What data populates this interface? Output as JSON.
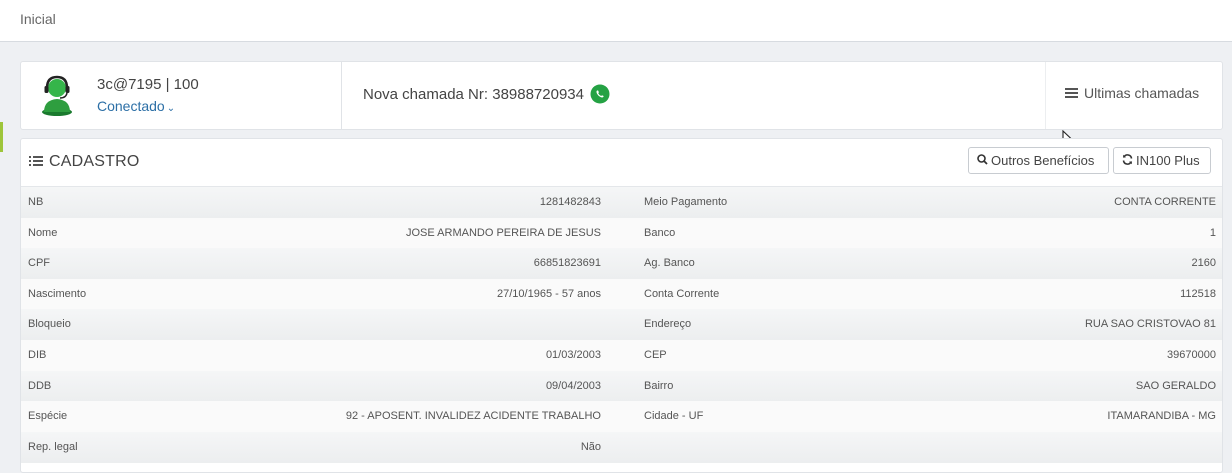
{
  "breadcrumb": {
    "label": "Inicial"
  },
  "agent": {
    "id_label": "3c@7195 | 100",
    "status": "Conectado",
    "status_color": "#2c6fa6"
  },
  "call": {
    "text": "Nova chamada Nr: 38988720934",
    "icon": "whatsapp-icon",
    "icon_color": "#25a244"
  },
  "last_calls": {
    "label": "Ultimas chamadas",
    "icon": "menu-icon"
  },
  "cadastro": {
    "title": "CADASTRO",
    "title_icon": "list-icon",
    "buttons": {
      "outros_beneficios": "Outros Benefícios",
      "in100_plus": "IN100 Plus"
    },
    "left_rows": [
      {
        "label": "NB",
        "value": "1281482843"
      },
      {
        "label": "Nome",
        "value": "JOSE ARMANDO PEREIRA DE JESUS"
      },
      {
        "label": "CPF",
        "value": "66851823691"
      },
      {
        "label": "Nascimento",
        "value": "27/10/1965 - 57 anos"
      },
      {
        "label": "Bloqueio",
        "value": ""
      },
      {
        "label": "DIB",
        "value": "01/03/2003"
      },
      {
        "label": "DDB",
        "value": "09/04/2003"
      },
      {
        "label": "Espécie",
        "value": "92 - APOSENT. INVALIDEZ ACIDENTE TRABALHO"
      },
      {
        "label": "Rep. legal",
        "value": "Não"
      }
    ],
    "right_rows": [
      {
        "label": "Meio Pagamento",
        "value": "CONTA CORRENTE"
      },
      {
        "label": "Banco",
        "value": "1"
      },
      {
        "label": "Ag. Banco",
        "value": "2160"
      },
      {
        "label": "Conta Corrente",
        "value": "112518"
      },
      {
        "label": "Endereço",
        "value": "RUA SAO CRISTOVAO 81"
      },
      {
        "label": "CEP",
        "value": "39670000"
      },
      {
        "label": "Bairro",
        "value": "SAO GERALDO"
      },
      {
        "label": "Cidade - UF",
        "value": "ITAMARANDIBA - MG"
      },
      {
        "label": "",
        "value": ""
      }
    ]
  }
}
